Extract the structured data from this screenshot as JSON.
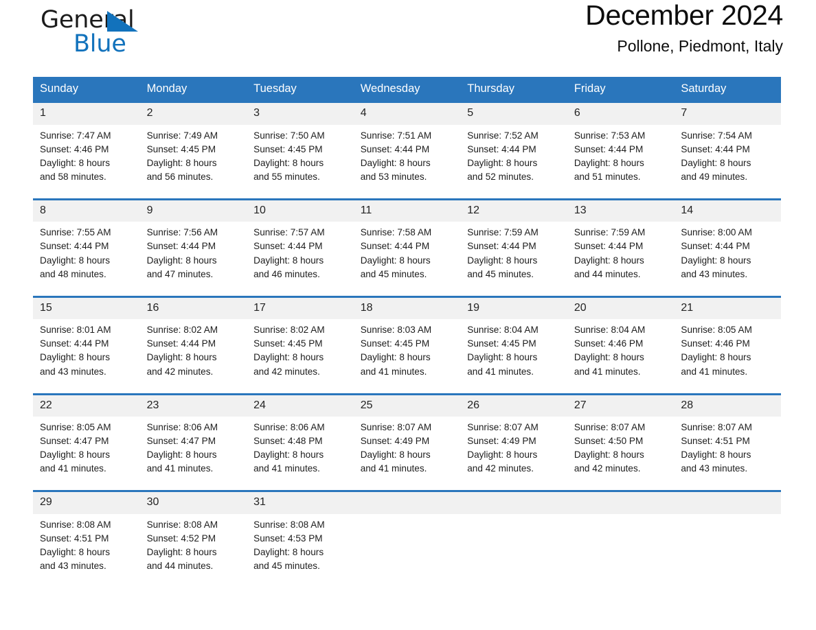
{
  "brand": {
    "name_part1": "General",
    "name_part2": "Blue",
    "triangle_color": "#1272BC",
    "blue_color": "#1272BC"
  },
  "header": {
    "title": "December 2024",
    "location": "Pollone, Piedmont, Italy"
  },
  "theme": {
    "header_blue": "#2A76BC",
    "daynum_gray": "#F1F1F1",
    "separator_blue": "#2A76BC",
    "text_color": "#1c1c1c"
  },
  "weekday_headers": [
    "Sunday",
    "Monday",
    "Tuesday",
    "Wednesday",
    "Thursday",
    "Friday",
    "Saturday"
  ],
  "weeks": [
    [
      {
        "day": "1",
        "sunrise": "Sunrise: 7:47 AM",
        "sunset": "Sunset: 4:46 PM",
        "daylight1": "Daylight: 8 hours",
        "daylight2": "and 58 minutes."
      },
      {
        "day": "2",
        "sunrise": "Sunrise: 7:49 AM",
        "sunset": "Sunset: 4:45 PM",
        "daylight1": "Daylight: 8 hours",
        "daylight2": "and 56 minutes."
      },
      {
        "day": "3",
        "sunrise": "Sunrise: 7:50 AM",
        "sunset": "Sunset: 4:45 PM",
        "daylight1": "Daylight: 8 hours",
        "daylight2": "and 55 minutes."
      },
      {
        "day": "4",
        "sunrise": "Sunrise: 7:51 AM",
        "sunset": "Sunset: 4:44 PM",
        "daylight1": "Daylight: 8 hours",
        "daylight2": "and 53 minutes."
      },
      {
        "day": "5",
        "sunrise": "Sunrise: 7:52 AM",
        "sunset": "Sunset: 4:44 PM",
        "daylight1": "Daylight: 8 hours",
        "daylight2": "and 52 minutes."
      },
      {
        "day": "6",
        "sunrise": "Sunrise: 7:53 AM",
        "sunset": "Sunset: 4:44 PM",
        "daylight1": "Daylight: 8 hours",
        "daylight2": "and 51 minutes."
      },
      {
        "day": "7",
        "sunrise": "Sunrise: 7:54 AM",
        "sunset": "Sunset: 4:44 PM",
        "daylight1": "Daylight: 8 hours",
        "daylight2": "and 49 minutes."
      }
    ],
    [
      {
        "day": "8",
        "sunrise": "Sunrise: 7:55 AM",
        "sunset": "Sunset: 4:44 PM",
        "daylight1": "Daylight: 8 hours",
        "daylight2": "and 48 minutes."
      },
      {
        "day": "9",
        "sunrise": "Sunrise: 7:56 AM",
        "sunset": "Sunset: 4:44 PM",
        "daylight1": "Daylight: 8 hours",
        "daylight2": "and 47 minutes."
      },
      {
        "day": "10",
        "sunrise": "Sunrise: 7:57 AM",
        "sunset": "Sunset: 4:44 PM",
        "daylight1": "Daylight: 8 hours",
        "daylight2": "and 46 minutes."
      },
      {
        "day": "11",
        "sunrise": "Sunrise: 7:58 AM",
        "sunset": "Sunset: 4:44 PM",
        "daylight1": "Daylight: 8 hours",
        "daylight2": "and 45 minutes."
      },
      {
        "day": "12",
        "sunrise": "Sunrise: 7:59 AM",
        "sunset": "Sunset: 4:44 PM",
        "daylight1": "Daylight: 8 hours",
        "daylight2": "and 45 minutes."
      },
      {
        "day": "13",
        "sunrise": "Sunrise: 7:59 AM",
        "sunset": "Sunset: 4:44 PM",
        "daylight1": "Daylight: 8 hours",
        "daylight2": "and 44 minutes."
      },
      {
        "day": "14",
        "sunrise": "Sunrise: 8:00 AM",
        "sunset": "Sunset: 4:44 PM",
        "daylight1": "Daylight: 8 hours",
        "daylight2": "and 43 minutes."
      }
    ],
    [
      {
        "day": "15",
        "sunrise": "Sunrise: 8:01 AM",
        "sunset": "Sunset: 4:44 PM",
        "daylight1": "Daylight: 8 hours",
        "daylight2": "and 43 minutes."
      },
      {
        "day": "16",
        "sunrise": "Sunrise: 8:02 AM",
        "sunset": "Sunset: 4:44 PM",
        "daylight1": "Daylight: 8 hours",
        "daylight2": "and 42 minutes."
      },
      {
        "day": "17",
        "sunrise": "Sunrise: 8:02 AM",
        "sunset": "Sunset: 4:45 PM",
        "daylight1": "Daylight: 8 hours",
        "daylight2": "and 42 minutes."
      },
      {
        "day": "18",
        "sunrise": "Sunrise: 8:03 AM",
        "sunset": "Sunset: 4:45 PM",
        "daylight1": "Daylight: 8 hours",
        "daylight2": "and 41 minutes."
      },
      {
        "day": "19",
        "sunrise": "Sunrise: 8:04 AM",
        "sunset": "Sunset: 4:45 PM",
        "daylight1": "Daylight: 8 hours",
        "daylight2": "and 41 minutes."
      },
      {
        "day": "20",
        "sunrise": "Sunrise: 8:04 AM",
        "sunset": "Sunset: 4:46 PM",
        "daylight1": "Daylight: 8 hours",
        "daylight2": "and 41 minutes."
      },
      {
        "day": "21",
        "sunrise": "Sunrise: 8:05 AM",
        "sunset": "Sunset: 4:46 PM",
        "daylight1": "Daylight: 8 hours",
        "daylight2": "and 41 minutes."
      }
    ],
    [
      {
        "day": "22",
        "sunrise": "Sunrise: 8:05 AM",
        "sunset": "Sunset: 4:47 PM",
        "daylight1": "Daylight: 8 hours",
        "daylight2": "and 41 minutes."
      },
      {
        "day": "23",
        "sunrise": "Sunrise: 8:06 AM",
        "sunset": "Sunset: 4:47 PM",
        "daylight1": "Daylight: 8 hours",
        "daylight2": "and 41 minutes."
      },
      {
        "day": "24",
        "sunrise": "Sunrise: 8:06 AM",
        "sunset": "Sunset: 4:48 PM",
        "daylight1": "Daylight: 8 hours",
        "daylight2": "and 41 minutes."
      },
      {
        "day": "25",
        "sunrise": "Sunrise: 8:07 AM",
        "sunset": "Sunset: 4:49 PM",
        "daylight1": "Daylight: 8 hours",
        "daylight2": "and 41 minutes."
      },
      {
        "day": "26",
        "sunrise": "Sunrise: 8:07 AM",
        "sunset": "Sunset: 4:49 PM",
        "daylight1": "Daylight: 8 hours",
        "daylight2": "and 42 minutes."
      },
      {
        "day": "27",
        "sunrise": "Sunrise: 8:07 AM",
        "sunset": "Sunset: 4:50 PM",
        "daylight1": "Daylight: 8 hours",
        "daylight2": "and 42 minutes."
      },
      {
        "day": "28",
        "sunrise": "Sunrise: 8:07 AM",
        "sunset": "Sunset: 4:51 PM",
        "daylight1": "Daylight: 8 hours",
        "daylight2": "and 43 minutes."
      }
    ],
    [
      {
        "day": "29",
        "sunrise": "Sunrise: 8:08 AM",
        "sunset": "Sunset: 4:51 PM",
        "daylight1": "Daylight: 8 hours",
        "daylight2": "and 43 minutes."
      },
      {
        "day": "30",
        "sunrise": "Sunrise: 8:08 AM",
        "sunset": "Sunset: 4:52 PM",
        "daylight1": "Daylight: 8 hours",
        "daylight2": "and 44 minutes."
      },
      {
        "day": "31",
        "sunrise": "Sunrise: 8:08 AM",
        "sunset": "Sunset: 4:53 PM",
        "daylight1": "Daylight: 8 hours",
        "daylight2": "and 45 minutes."
      },
      {
        "day": "",
        "sunrise": "",
        "sunset": "",
        "daylight1": "",
        "daylight2": ""
      },
      {
        "day": "",
        "sunrise": "",
        "sunset": "",
        "daylight1": "",
        "daylight2": ""
      },
      {
        "day": "",
        "sunrise": "",
        "sunset": "",
        "daylight1": "",
        "daylight2": ""
      },
      {
        "day": "",
        "sunrise": "",
        "sunset": "",
        "daylight1": "",
        "daylight2": ""
      }
    ]
  ]
}
